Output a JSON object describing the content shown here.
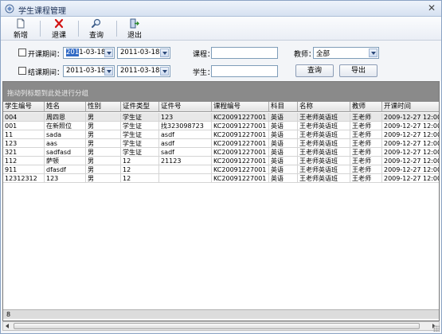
{
  "window": {
    "title": "学生课程管理"
  },
  "toolbar": {
    "add_label": "新增",
    "drop_label": "退课",
    "query_label": "查询",
    "exit_label": "退出"
  },
  "filter": {
    "start_period_label": "开课期间：",
    "end_period_label": "结课期间：",
    "start_from": "2011-03-18",
    "start_from_selected": "201",
    "start_from_rest": "1-03-18",
    "start_to": "2011-03-18",
    "end_from": "2011-03-18",
    "end_to": "2011-03-18",
    "course_label": "课程：",
    "teacher_label": "教师：",
    "teacher_value": "全部",
    "student_label": "学生：",
    "query_button": "查询",
    "export_button": "导出"
  },
  "grid": {
    "group_hint": "拖动列标题到此处进行分组",
    "columns": [
      "学生编号",
      "姓名",
      "性别",
      "证件类型",
      "证件号",
      "课程编号",
      "科目",
      "名称",
      "教师",
      "开课时间"
    ],
    "rows": [
      [
        "004",
        "周四恩",
        "男",
        "学生证",
        "123",
        "KC20091227001",
        "英语",
        "王老师英语班",
        "王老师",
        "2009-12-27 12:00:2"
      ],
      [
        "001",
        "在新照位",
        "男",
        "学生证",
        "找323098723",
        "KC20091227001",
        "英语",
        "王老师英语班",
        "王老师",
        "2009-12-27 12:00:2"
      ],
      [
        "11",
        "sada",
        "男",
        "学生证",
        "asdf",
        "KC20091227001",
        "英语",
        "王老师英语班",
        "王老师",
        "2009-12-27 12:00:2"
      ],
      [
        "123",
        "aas",
        "男",
        "学生证",
        "asdf",
        "KC20091227001",
        "英语",
        "王老师英语班",
        "王老师",
        "2009-12-27 12:00:2"
      ],
      [
        "321",
        "sadfasd",
        "男",
        "学生证",
        "sadf",
        "KC20091227001",
        "英语",
        "王老师英语班",
        "王老师",
        "2009-12-27 12:00:2"
      ],
      [
        "112",
        "萨顿",
        "男",
        "12",
        "21123",
        "KC20091227001",
        "英语",
        "王老师英语班",
        "王老师",
        "2009-12-27 12:00:2"
      ],
      [
        "911",
        "dfasdf",
        "男",
        "12",
        "",
        "KC20091227001",
        "英语",
        "王老师英语班",
        "王老师",
        "2009-12-27 12:00:2"
      ],
      [
        "12312312",
        "123",
        "男",
        "12",
        "",
        "KC20091227001",
        "英语",
        "王老师英语班",
        "王老师",
        "2009-12-27 12:00:2"
      ]
    ],
    "record_count": "8"
  }
}
